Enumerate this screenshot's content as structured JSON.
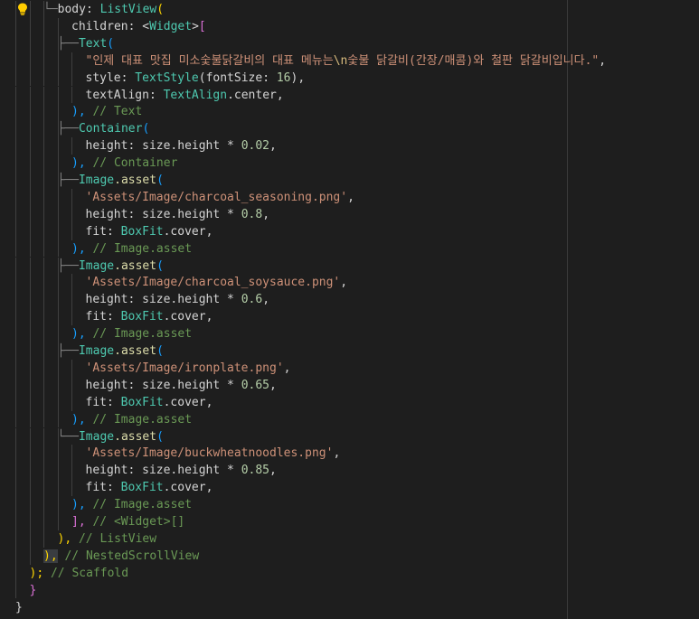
{
  "theme": {
    "background": "#1e1e1e",
    "text": "#d4d4d4",
    "class": "#4ec9b0",
    "string": "#ce9178",
    "comment": "#6a9955",
    "keyword_param": "#9cdcfe",
    "function": "#dcdcaa",
    "number": "#b5cea8",
    "bracket_gold": "#ffd700",
    "bracket_purple": "#da70d6",
    "bracket_blue": "#179fff",
    "tree_line": "#808080",
    "escape": "#d7ba7d"
  },
  "lightbulb": {
    "icon": "lightbulb-icon",
    "color": "#ffcc00"
  },
  "lines": [
    {
      "indent": 3,
      "tree": "└─",
      "tokens": [
        [
          "body",
          "tx"
        ],
        [
          ": ",
          "tx"
        ],
        [
          "ListView",
          "cls"
        ],
        [
          "(",
          "bg"
        ]
      ]
    },
    {
      "indent": 4,
      "tokens": [
        [
          "children",
          "tx"
        ],
        [
          ": <",
          "tx"
        ],
        [
          "Widget",
          "cls"
        ],
        [
          ">",
          "tx"
        ],
        [
          "[",
          "bp"
        ]
      ]
    },
    {
      "indent": 4,
      "tree": "├──",
      "tokens": [
        [
          "Text",
          "cls"
        ],
        [
          "(",
          "bb"
        ]
      ]
    },
    {
      "indent": 5,
      "tokens": [
        [
          "\"인제 대표 맛집 미소숯불닭갈비의 대표 메뉴는",
          "str"
        ],
        [
          "\\n",
          "esc"
        ],
        [
          "숯불 닭갈비(간장/매콤)와 철판 닭갈비입니다.\"",
          "str"
        ],
        [
          ",",
          "tx"
        ]
      ]
    },
    {
      "indent": 5,
      "tokens": [
        [
          "style",
          "tx"
        ],
        [
          ": ",
          "tx"
        ],
        [
          "TextStyle",
          "cls"
        ],
        [
          "(",
          "tx"
        ],
        [
          "fontSize",
          "tx"
        ],
        [
          ": ",
          "tx"
        ],
        [
          "16",
          "num"
        ],
        [
          "),",
          "tx"
        ]
      ]
    },
    {
      "indent": 5,
      "tokens": [
        [
          "textAlign",
          "tx"
        ],
        [
          ": ",
          "tx"
        ],
        [
          "TextAlign",
          "cls"
        ],
        [
          ".center,",
          "tx"
        ]
      ]
    },
    {
      "indent": 4,
      "tokens": [
        [
          "),",
          "bb"
        ],
        [
          " // Text",
          "cmt"
        ]
      ]
    },
    {
      "indent": 4,
      "tree": "├──",
      "tokens": [
        [
          "Container",
          "cls"
        ],
        [
          "(",
          "bb"
        ]
      ]
    },
    {
      "indent": 5,
      "tokens": [
        [
          "height",
          "tx"
        ],
        [
          ": size.height * ",
          "tx"
        ],
        [
          "0.02",
          "num"
        ],
        [
          ",",
          "tx"
        ]
      ]
    },
    {
      "indent": 4,
      "tokens": [
        [
          "),",
          "bb"
        ],
        [
          " // Container",
          "cmt"
        ]
      ]
    },
    {
      "indent": 4,
      "tree": "├──",
      "tokens": [
        [
          "Image",
          "cls"
        ],
        [
          ".asset",
          "fn"
        ],
        [
          "(",
          "bb"
        ]
      ]
    },
    {
      "indent": 5,
      "tokens": [
        [
          "'Assets/Image/charcoal_seasoning.png'",
          "str"
        ],
        [
          ",",
          "tx"
        ]
      ]
    },
    {
      "indent": 5,
      "tokens": [
        [
          "height",
          "tx"
        ],
        [
          ": size.height * ",
          "tx"
        ],
        [
          "0.8",
          "num"
        ],
        [
          ",",
          "tx"
        ]
      ]
    },
    {
      "indent": 5,
      "tokens": [
        [
          "fit",
          "tx"
        ],
        [
          ": ",
          "tx"
        ],
        [
          "BoxFit",
          "cls"
        ],
        [
          ".cover,",
          "tx"
        ]
      ]
    },
    {
      "indent": 4,
      "tokens": [
        [
          "),",
          "bb"
        ],
        [
          " // Image.asset",
          "cmt"
        ]
      ]
    },
    {
      "indent": 4,
      "tree": "├──",
      "tokens": [
        [
          "Image",
          "cls"
        ],
        [
          ".asset",
          "fn"
        ],
        [
          "(",
          "bb"
        ]
      ]
    },
    {
      "indent": 5,
      "tokens": [
        [
          "'Assets/Image/charcoal_soysauce.png'",
          "str"
        ],
        [
          ",",
          "tx"
        ]
      ]
    },
    {
      "indent": 5,
      "tokens": [
        [
          "height",
          "tx"
        ],
        [
          ": size.height * ",
          "tx"
        ],
        [
          "0.6",
          "num"
        ],
        [
          ",",
          "tx"
        ]
      ]
    },
    {
      "indent": 5,
      "tokens": [
        [
          "fit",
          "tx"
        ],
        [
          ": ",
          "tx"
        ],
        [
          "BoxFit",
          "cls"
        ],
        [
          ".cover,",
          "tx"
        ]
      ]
    },
    {
      "indent": 4,
      "tokens": [
        [
          "),",
          "bb"
        ],
        [
          " // Image.asset",
          "cmt"
        ]
      ]
    },
    {
      "indent": 4,
      "tree": "├──",
      "tokens": [
        [
          "Image",
          "cls"
        ],
        [
          ".asset",
          "fn"
        ],
        [
          "(",
          "bb"
        ]
      ]
    },
    {
      "indent": 5,
      "tokens": [
        [
          "'Assets/Image/ironplate.png'",
          "str"
        ],
        [
          ",",
          "tx"
        ]
      ]
    },
    {
      "indent": 5,
      "tokens": [
        [
          "height",
          "tx"
        ],
        [
          ": size.height * ",
          "tx"
        ],
        [
          "0.65",
          "num"
        ],
        [
          ",",
          "tx"
        ]
      ]
    },
    {
      "indent": 5,
      "tokens": [
        [
          "fit",
          "tx"
        ],
        [
          ": ",
          "tx"
        ],
        [
          "BoxFit",
          "cls"
        ],
        [
          ".cover,",
          "tx"
        ]
      ]
    },
    {
      "indent": 4,
      "tokens": [
        [
          "),",
          "bb"
        ],
        [
          " // Image.asset",
          "cmt"
        ]
      ]
    },
    {
      "indent": 4,
      "tree": "└──",
      "tokens": [
        [
          "Image",
          "cls"
        ],
        [
          ".asset",
          "fn"
        ],
        [
          "(",
          "bb"
        ]
      ]
    },
    {
      "indent": 5,
      "tokens": [
        [
          "'Assets/Image/buckwheatnoodles.png'",
          "str"
        ],
        [
          ",",
          "tx"
        ]
      ]
    },
    {
      "indent": 5,
      "tokens": [
        [
          "height",
          "tx"
        ],
        [
          ": size.height * ",
          "tx"
        ],
        [
          "0.85",
          "num"
        ],
        [
          ",",
          "tx"
        ]
      ]
    },
    {
      "indent": 5,
      "tokens": [
        [
          "fit",
          "tx"
        ],
        [
          ": ",
          "tx"
        ],
        [
          "BoxFit",
          "cls"
        ],
        [
          ".cover,",
          "tx"
        ]
      ]
    },
    {
      "indent": 4,
      "tokens": [
        [
          "),",
          "bb"
        ],
        [
          " // Image.asset",
          "cmt"
        ]
      ]
    },
    {
      "indent": 4,
      "tokens": [
        [
          "],",
          "bp"
        ],
        [
          " // <Widget>[]",
          "cmt"
        ]
      ]
    },
    {
      "indent": 3,
      "tokens": [
        [
          "),",
          "bg"
        ],
        [
          " // ListView",
          "cmt"
        ]
      ]
    },
    {
      "indent": 2,
      "tokens": [
        [
          "),",
          "box"
        ],
        [
          " // NestedScrollView",
          "cmt"
        ]
      ]
    },
    {
      "indent": 1,
      "tokens": [
        [
          ");",
          "bg"
        ],
        [
          " // Scaffold",
          "cmt"
        ]
      ]
    },
    {
      "indent": 1,
      "tokens": [
        [
          "}",
          "bp"
        ]
      ]
    },
    {
      "indent": 0,
      "tokens": [
        [
          "}",
          "tx"
        ]
      ]
    }
  ]
}
